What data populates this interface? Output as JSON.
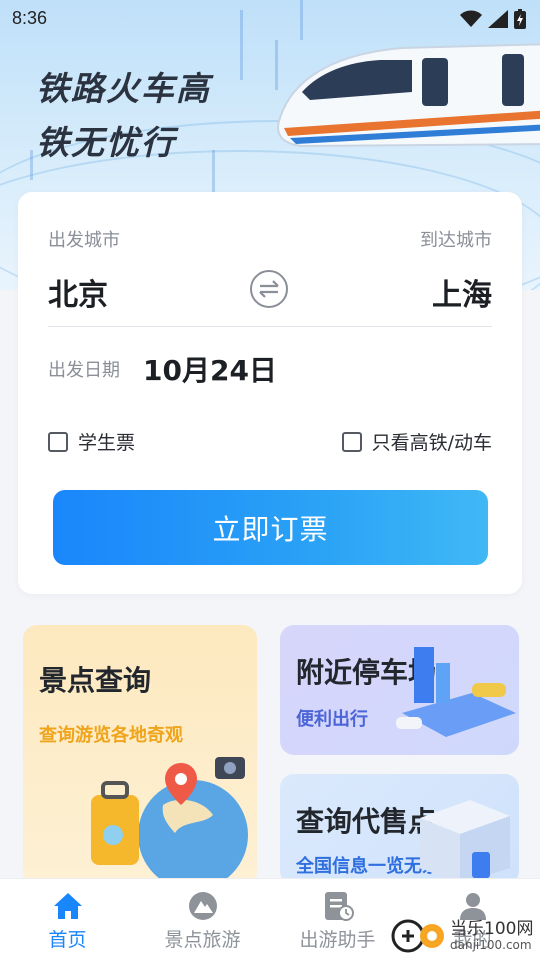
{
  "status_bar": {
    "time": "8:36"
  },
  "banner": {
    "slogan_line1": "铁路火车高",
    "slogan_line2": "铁无忧行"
  },
  "booking": {
    "from_label": "出发城市",
    "to_label": "到达城市",
    "from_city": "北京",
    "to_city": "上海",
    "date_label": "出发日期",
    "date_value": "10月24日",
    "option_student": "学生票",
    "option_highspeed": "只看高铁/动车",
    "book_button": "立即订票"
  },
  "tiles": {
    "scenic": {
      "title": "景点查询",
      "subtitle": "查询游览各地奇观"
    },
    "parking": {
      "title": "附近停车场",
      "subtitle": "便利出行"
    },
    "agency": {
      "title": "查询代售点",
      "subtitle": "全国信息一览无余"
    }
  },
  "tabbar": [
    {
      "label": "首页",
      "icon": "home-icon",
      "active": true
    },
    {
      "label": "景点旅游",
      "icon": "mountain-icon",
      "active": false
    },
    {
      "label": "出游助手",
      "icon": "clipboard-clock-icon",
      "active": false
    },
    {
      "label": "我的",
      "icon": "user-icon",
      "active": false
    }
  ],
  "watermark": {
    "text": "当乐100网",
    "url_text": "danji100.com"
  },
  "colors": {
    "accent": "#1a86fb",
    "scenic_bg": "#fde9c0",
    "parking_bg": "#d7d9fb",
    "agency_bg": "#dbe9fc"
  }
}
